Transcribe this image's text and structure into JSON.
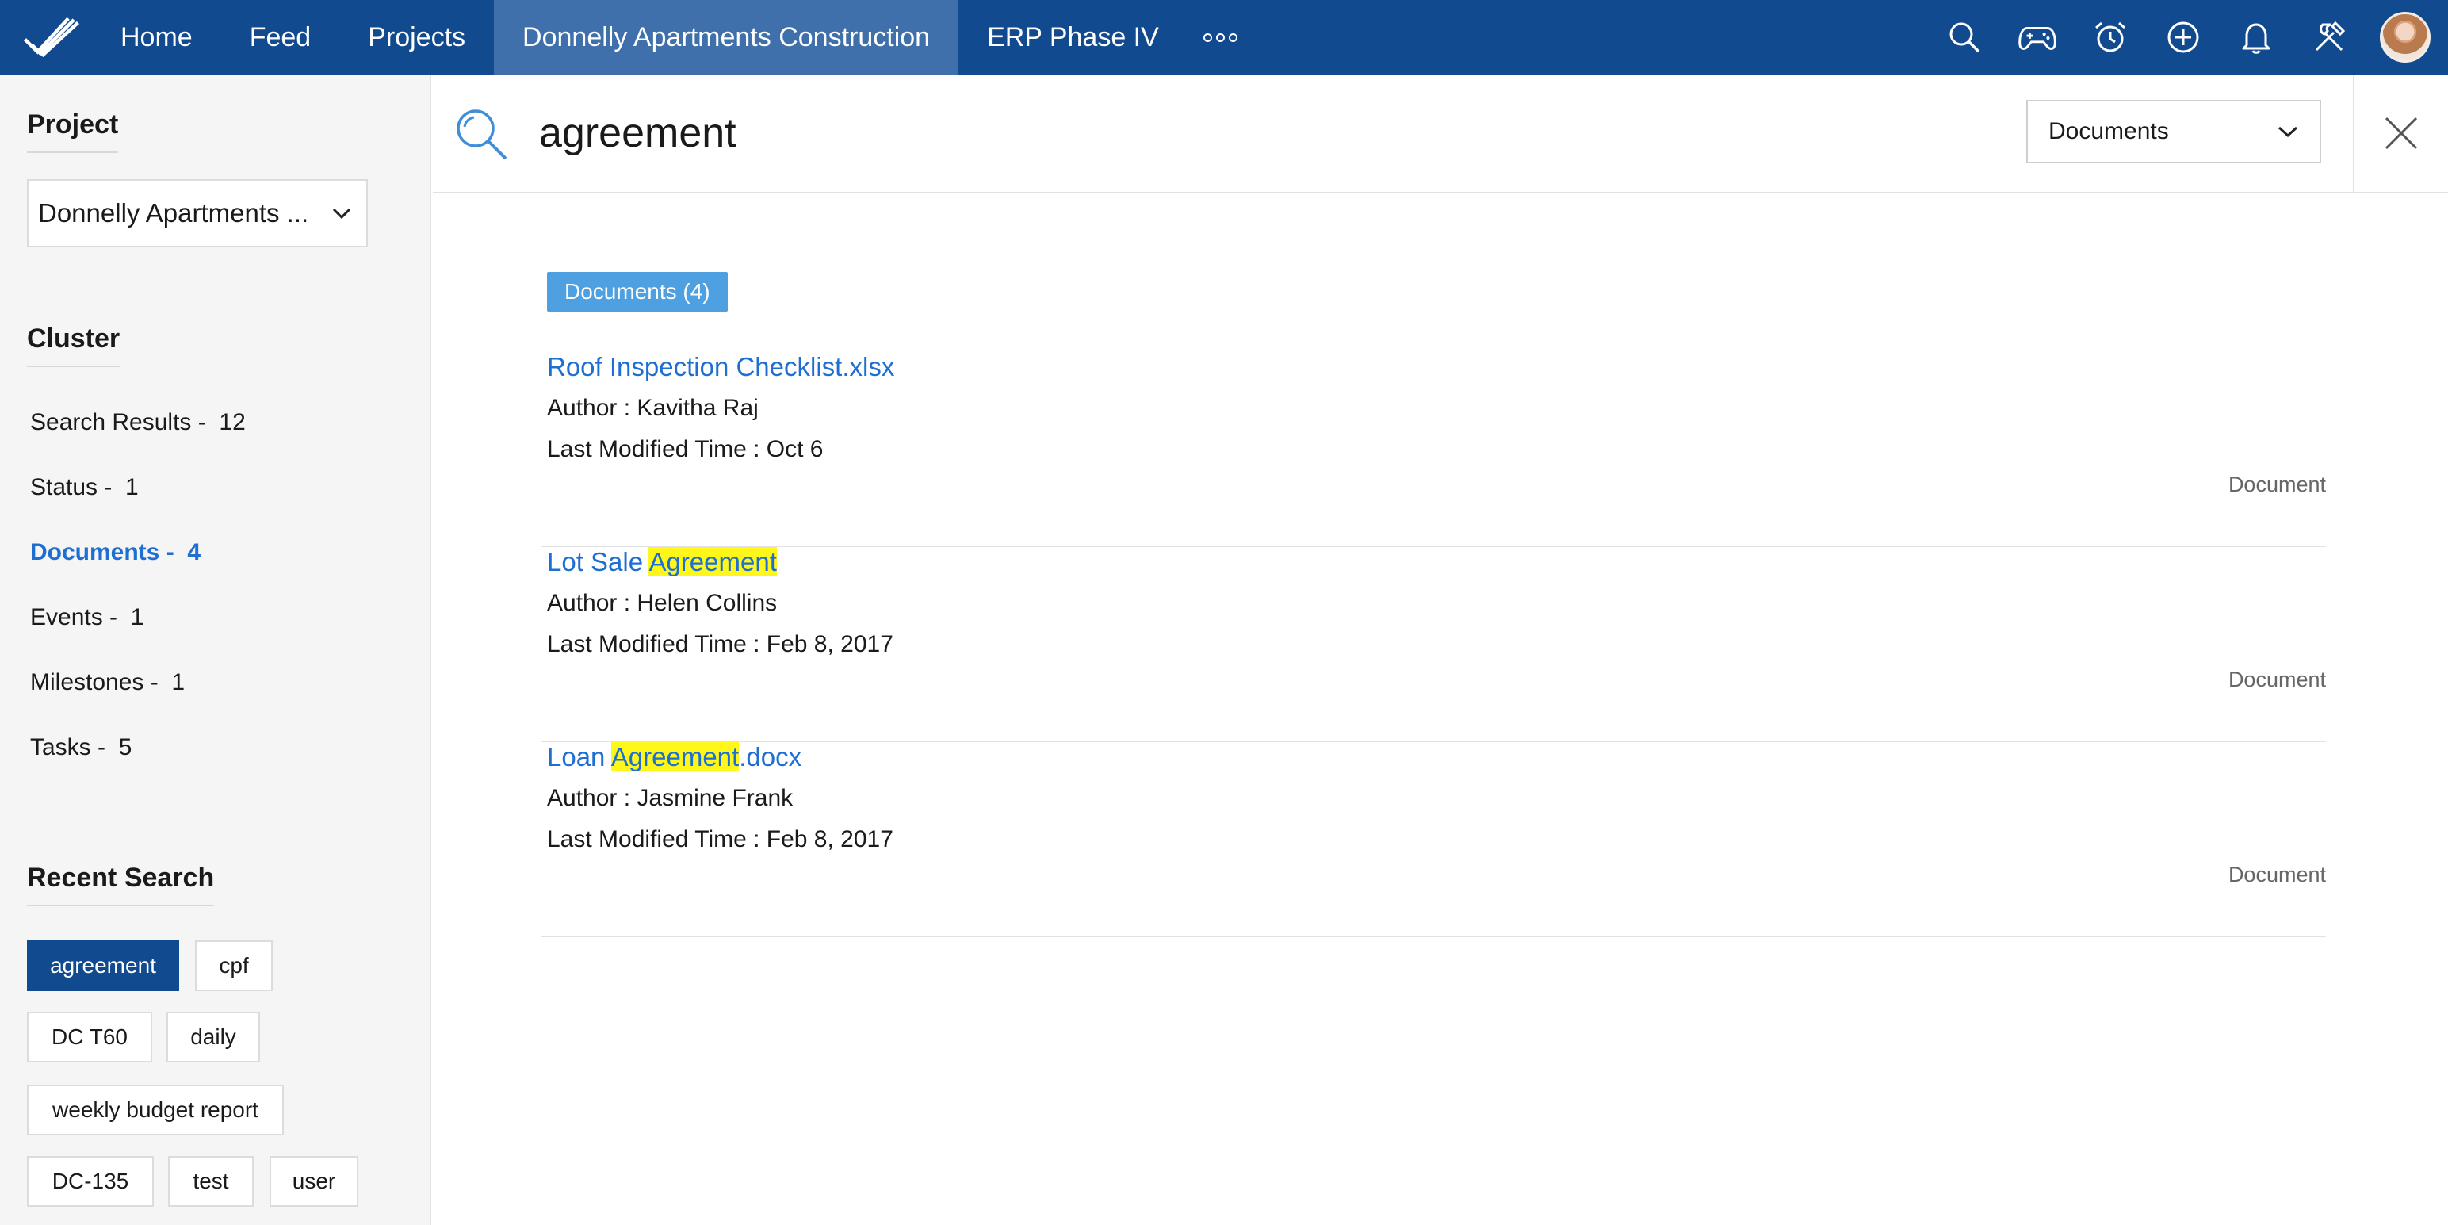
{
  "nav": {
    "items": [
      "Home",
      "Feed",
      "Projects",
      "Donnelly Apartments Construction",
      "ERP Phase IV"
    ],
    "active_index": 3,
    "right_icons": [
      "search-icon",
      "gamepad-icon",
      "alarm-clock-icon",
      "plus-circle-icon",
      "bell-icon",
      "tools-icon"
    ]
  },
  "sidebar": {
    "project_heading": "Project",
    "project_value": "Donnelly Apartments ...",
    "cluster_heading": "Cluster",
    "cluster_items": [
      {
        "label": "Search Results -  12",
        "active": false
      },
      {
        "label": "Status -  1",
        "active": false
      },
      {
        "label": "Documents -  4",
        "active": true
      },
      {
        "label": "Events -  1",
        "active": false
      },
      {
        "label": "Milestones -  1",
        "active": false
      },
      {
        "label": "Tasks -  5",
        "active": false
      }
    ],
    "recent_heading": "Recent Search",
    "recent_tags": [
      {
        "label": "agreement",
        "active": true
      },
      {
        "label": "cpf",
        "active": false
      },
      {
        "label": "DC T60",
        "active": false
      },
      {
        "label": "daily",
        "active": false
      },
      {
        "label": "weekly budget report",
        "active": false
      },
      {
        "label": "DC-135",
        "active": false
      },
      {
        "label": "test",
        "active": false
      },
      {
        "label": "user",
        "active": false
      }
    ]
  },
  "search": {
    "query": "agreement",
    "scope": "Documents"
  },
  "results": {
    "badge": "Documents (4)",
    "items": [
      {
        "title_parts": [
          "Roof Inspection Checklist.xlsx",
          "",
          ""
        ],
        "author": "Author : Kavitha Raj",
        "modified": "Last Modified Time : Oct 6",
        "type": "Document"
      },
      {
        "title_parts": [
          "Lot Sale ",
          "Agreement",
          ""
        ],
        "author": "Author : Helen Collins",
        "modified": "Last Modified Time : Feb 8, 2017",
        "type": "Document"
      },
      {
        "title_parts": [
          "Loan ",
          "Agreement",
          ".docx"
        ],
        "author": "Author : Jasmine Frank",
        "modified": "Last Modified Time : Feb 8, 2017",
        "type": "Document"
      }
    ]
  },
  "colors": {
    "nav_bg": "#124a8f",
    "nav_active": "#3f70ab",
    "link": "#1e6fd1",
    "badge": "#4ea0e0",
    "highlight": "#fff719"
  }
}
